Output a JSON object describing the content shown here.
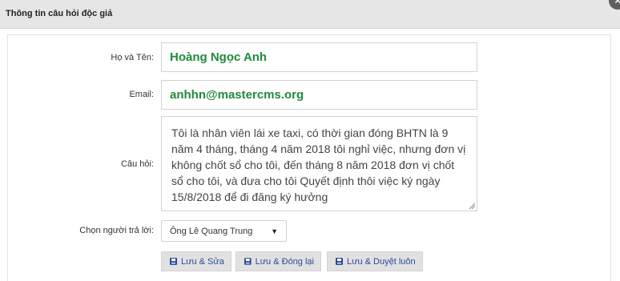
{
  "modal": {
    "title": "Thông tin câu hỏi độc giả",
    "close_glyph": "×"
  },
  "form": {
    "name": {
      "label": "Họ và Tên:",
      "value": "Hoàng Ngọc Anh"
    },
    "email": {
      "label": "Email:",
      "value": "anhhn@mastercms.org"
    },
    "question": {
      "label": "Câu hỏi:",
      "value": "Tôi là nhân viên lái xe taxi, có thời gian đóng BHTN là 9 năm 4 tháng, tháng 4 năm 2018 tôi nghỉ việc, nhưng đơn vị không chốt sổ cho tôi, đến tháng 8 năm 2018 đơn vị chốt sổ cho tôi, và đưa cho tôi Quyết định thôi việc ký ngày 15/8/2018 để đi đăng ký hưởng"
    },
    "responder": {
      "label": "Chọn người trả lời:",
      "selected": "Ông Lê Quang Trung"
    }
  },
  "actions": {
    "save_edit": "Lưu & Sửa",
    "save_close": "Lưu & Đóng lại",
    "save_approve": "Lưu & Duyệt luôn"
  },
  "colors": {
    "header_bg": "#e6e6e6",
    "value_green": "#1f8a3b",
    "button_text_blue": "#2c4a99",
    "button_bg": "#e1e1e1",
    "close_bg": "#5f5f5f"
  },
  "icons": {
    "close": "close-icon",
    "save": "floppy-disk-icon",
    "dropdown": "caret-down-icon"
  }
}
